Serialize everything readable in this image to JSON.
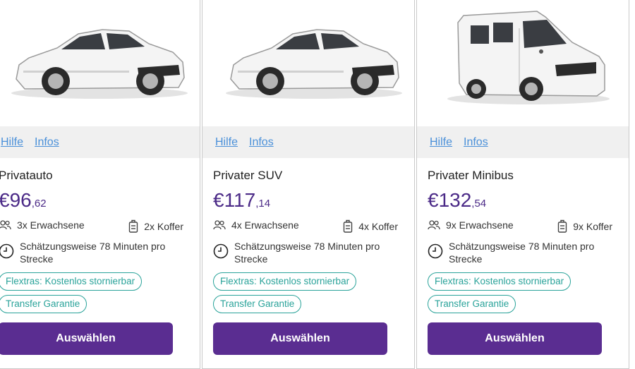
{
  "cards": [
    {
      "vehicle_icon": "car-sedan-icon",
      "links": {
        "help": "Hilfe",
        "info": "Infos"
      },
      "title": "Privatauto",
      "price": {
        "main": "€96",
        "cents": ",62"
      },
      "passengers": "3x Erwachsene",
      "luggage": "2x Koffer",
      "estimate": "Schätzungsweise 78 Minuten pro Strecke",
      "badges": [
        "Flextras: Kostenlos stornierbar",
        "Transfer Garantie"
      ],
      "button": "Auswählen"
    },
    {
      "vehicle_icon": "car-sedan-icon",
      "links": {
        "help": "Hilfe",
        "info": "Infos"
      },
      "title": "Privater SUV",
      "price": {
        "main": "€117",
        "cents": ",14"
      },
      "passengers": "4x Erwachsene",
      "luggage": "4x Koffer",
      "estimate": "Schätzungsweise 78 Minuten pro Strecke",
      "badges": [
        "Flextras: Kostenlos stornierbar",
        "Transfer Garantie"
      ],
      "button": "Auswählen"
    },
    {
      "vehicle_icon": "minibus-icon",
      "links": {
        "help": "Hilfe",
        "info": "Infos"
      },
      "title": "Privater Minibus",
      "price": {
        "main": "€132",
        "cents": ",54"
      },
      "passengers": "9x Erwachsene",
      "luggage": "9x Koffer",
      "estimate": "Schätzungsweise 78 Minuten pro Strecke",
      "badges": [
        "Flextras: Kostenlos stornierbar",
        "Transfer Garantie"
      ],
      "button": "Auswählen"
    }
  ],
  "colors": {
    "accent": "#5a2d91",
    "price": "#4b2a87",
    "link": "#4a90d9",
    "badge": "#2aa39a",
    "links_bar_bg": "#f0f0f0"
  }
}
